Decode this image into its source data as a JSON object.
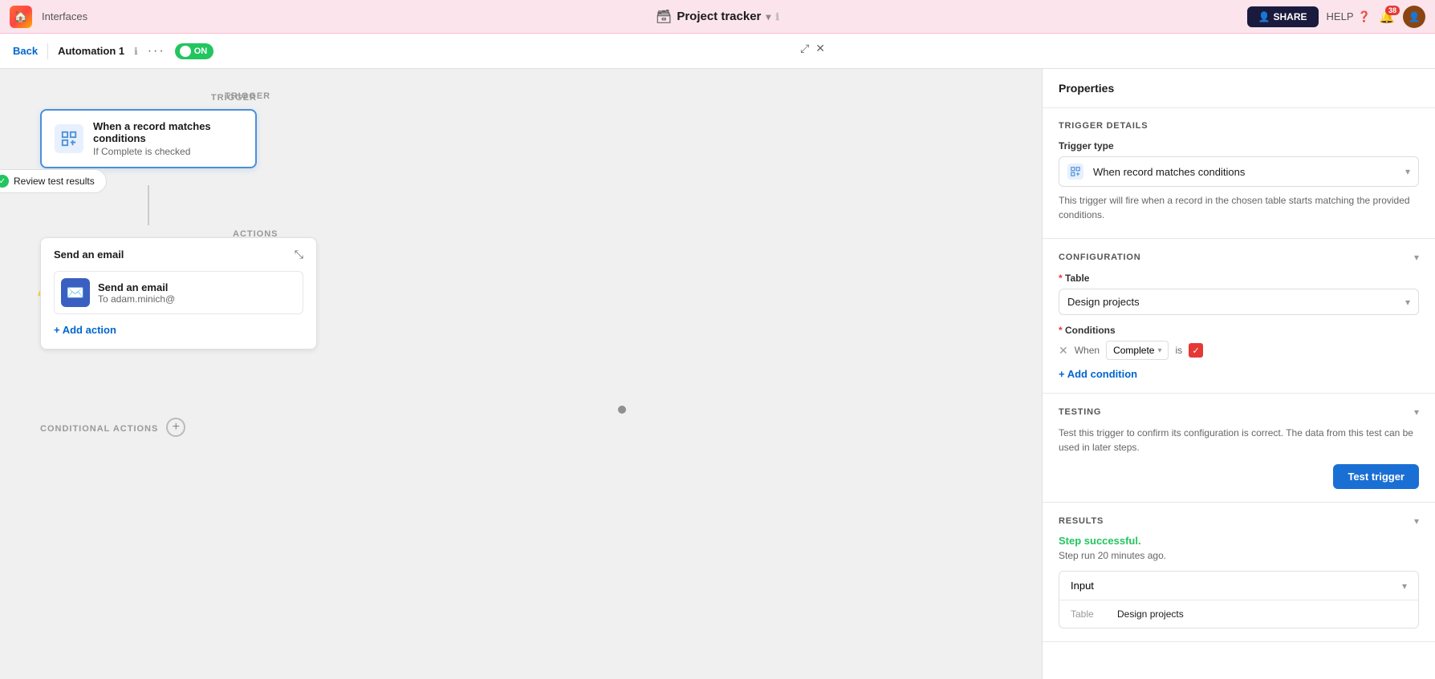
{
  "topnav": {
    "logo_emoji": "🏠",
    "interfaces_label": "Interfaces",
    "title": "Project tracker",
    "title_icon": "🗃",
    "share_label": "SHARE",
    "help_label": "HELP",
    "notif_count": "38"
  },
  "subnav": {
    "back_label": "Back",
    "automation_name": "Automation 1",
    "toggle_label": "ON"
  },
  "canvas": {
    "trigger_section_label": "TRIGGER",
    "trigger_title": "When a record matches conditions",
    "trigger_subtitle": "If Complete is checked",
    "review_btn_label": "Review test results",
    "actions_section_label": "ACTIONS",
    "action_card_title": "Send an email",
    "action_item_title": "Send an email",
    "action_item_subtitle": "To adam.minich@",
    "add_action_label": "+ Add action",
    "conditional_section_label": "CONDITIONAL ACTIONS"
  },
  "properties": {
    "panel_title": "Properties",
    "trigger_details_title": "TRIGGER DETAILS",
    "trigger_type_label": "Trigger type",
    "trigger_type_value": "When record matches conditions",
    "trigger_description": "This trigger will fire when a record in the chosen table starts matching the provided conditions.",
    "configuration_title": "CONFIGURATION",
    "table_label": "Table",
    "table_value": "Design projects",
    "conditions_label": "Conditions",
    "condition_when": "When",
    "condition_field": "Complete",
    "condition_is": "is",
    "add_condition_label": "+ Add condition",
    "testing_title": "TESTING",
    "testing_description": "Test this trigger to confirm its configuration is correct. The data from this test can be used in later steps.",
    "test_trigger_btn": "Test trigger",
    "results_title": "RESULTS",
    "step_successful": "Step successful.",
    "step_time": "Step run 20 minutes ago.",
    "input_label": "Input",
    "table_input_label": "Table",
    "table_input_value": "Design projects"
  }
}
